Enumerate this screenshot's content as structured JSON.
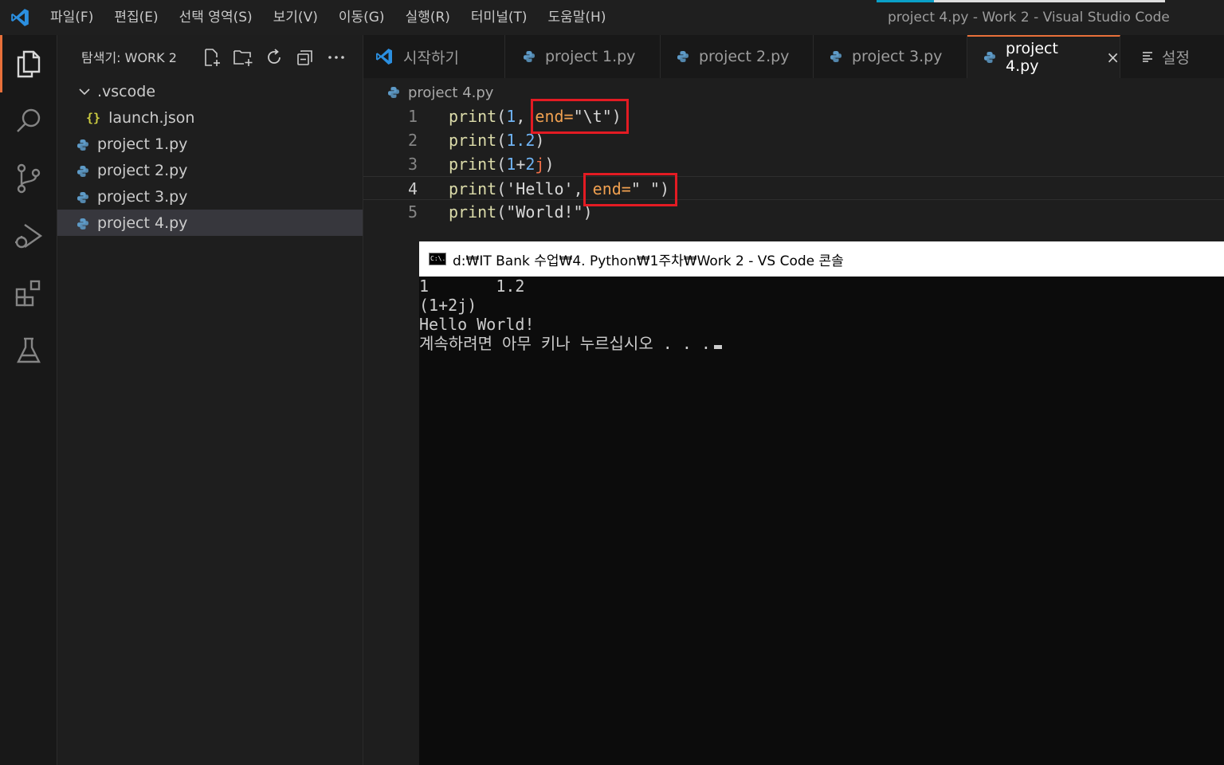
{
  "titlebar": {
    "menu": [
      "파일(F)",
      "편집(E)",
      "선택 영역(S)",
      "보기(V)",
      "이동(G)",
      "실행(R)",
      "터미널(T)",
      "도움말(H)"
    ],
    "window_title": "project 4.py - Work 2 - Visual Studio Code"
  },
  "sidebar": {
    "title": "탐색기: WORK 2",
    "tree": [
      {
        "label": ".vscode",
        "kind": "folder"
      },
      {
        "label": "launch.json",
        "kind": "json"
      },
      {
        "label": "project 1.py",
        "kind": "py"
      },
      {
        "label": "project 2.py",
        "kind": "py"
      },
      {
        "label": "project 3.py",
        "kind": "py"
      },
      {
        "label": "project 4.py",
        "kind": "py",
        "selected": true
      }
    ]
  },
  "tabs": [
    {
      "label": "시작하기"
    },
    {
      "label": "project 1.py"
    },
    {
      "label": "project 2.py"
    },
    {
      "label": "project 3.py"
    },
    {
      "label": "project 4.py",
      "active": true,
      "close": "×"
    },
    {
      "label": "설정"
    }
  ],
  "editor": {
    "breadcrumb": "project 4.py",
    "line_numbers": [
      "1",
      "2",
      "3",
      "4",
      "5"
    ],
    "lines": [
      [
        "print",
        "(",
        "1",
        ", ",
        "end=",
        "\"\\t\"",
        ")"
      ],
      [
        "print",
        "(",
        "1.2",
        ")"
      ],
      [
        "print",
        "(",
        "1",
        "+",
        "2",
        "j",
        ")"
      ],
      [
        "print",
        "(",
        "'Hello'",
        ", ",
        "end=",
        "\" \"",
        ")"
      ],
      [
        "print",
        "(",
        "\"World!\"",
        ")"
      ]
    ]
  },
  "console": {
    "title": "d:₩IT Bank 수업₩4. Python₩1주차₩Work 2 - VS Code 콘솔",
    "icon_text": "C:\\.",
    "output": [
      "1       1.2",
      "(1+2j)",
      "Hello World!",
      "계속하려면 아무 키나 누르십시오 . . ."
    ]
  },
  "colors": {
    "accent": "#e8703a",
    "highlight": "#e31b23"
  }
}
